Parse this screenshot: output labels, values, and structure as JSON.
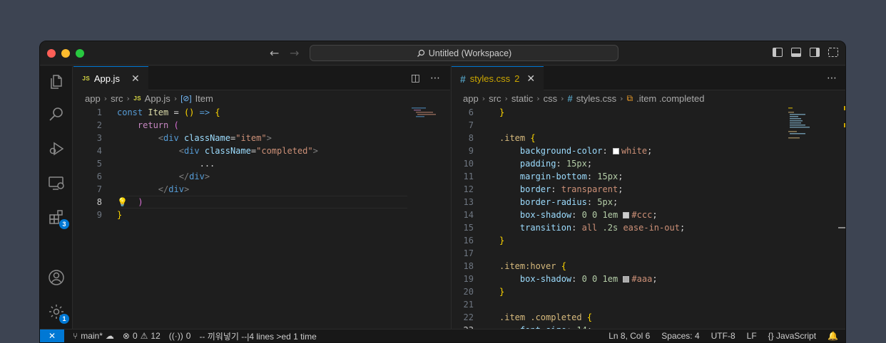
{
  "window": {
    "title": "Untitled (Workspace)"
  },
  "activity_bar": {
    "icons": [
      "explorer-icon",
      "search-icon",
      "run-debug-icon",
      "remote-explorer-icon",
      "extensions-icon",
      "accounts-icon",
      "manage-icon"
    ],
    "extensions_badge": "3",
    "manage_badge": "1"
  },
  "left_editor": {
    "tab": {
      "icon": "JS",
      "label": "App.js",
      "close": "✕"
    },
    "breadcrumb": [
      "app",
      "src",
      "App.js",
      "Item"
    ],
    "current_line": 8
  },
  "right_editor": {
    "tab": {
      "icon": "#",
      "label": "styles.css",
      "problems": "2",
      "close": "✕"
    },
    "breadcrumb": [
      "app",
      "src",
      "static",
      "css",
      "styles.css",
      ".item .completed"
    ]
  },
  "colors": {
    "accent": "#0078d4",
    "white_swatch": "#ffffff",
    "ccc_swatch": "#cccccc",
    "aaa_swatch": "#aaaaaa"
  },
  "status_bar": {
    "branch": "main*",
    "errors": "0",
    "warnings": "12",
    "ports": "0",
    "vim_mode": "-- 끼워넣기 --|4 lines >ed 1 time",
    "cursor": "Ln 8, Col 6",
    "indent": "Spaces: 4",
    "encoding": "UTF-8",
    "eol": "LF",
    "language": "JavaScript"
  }
}
